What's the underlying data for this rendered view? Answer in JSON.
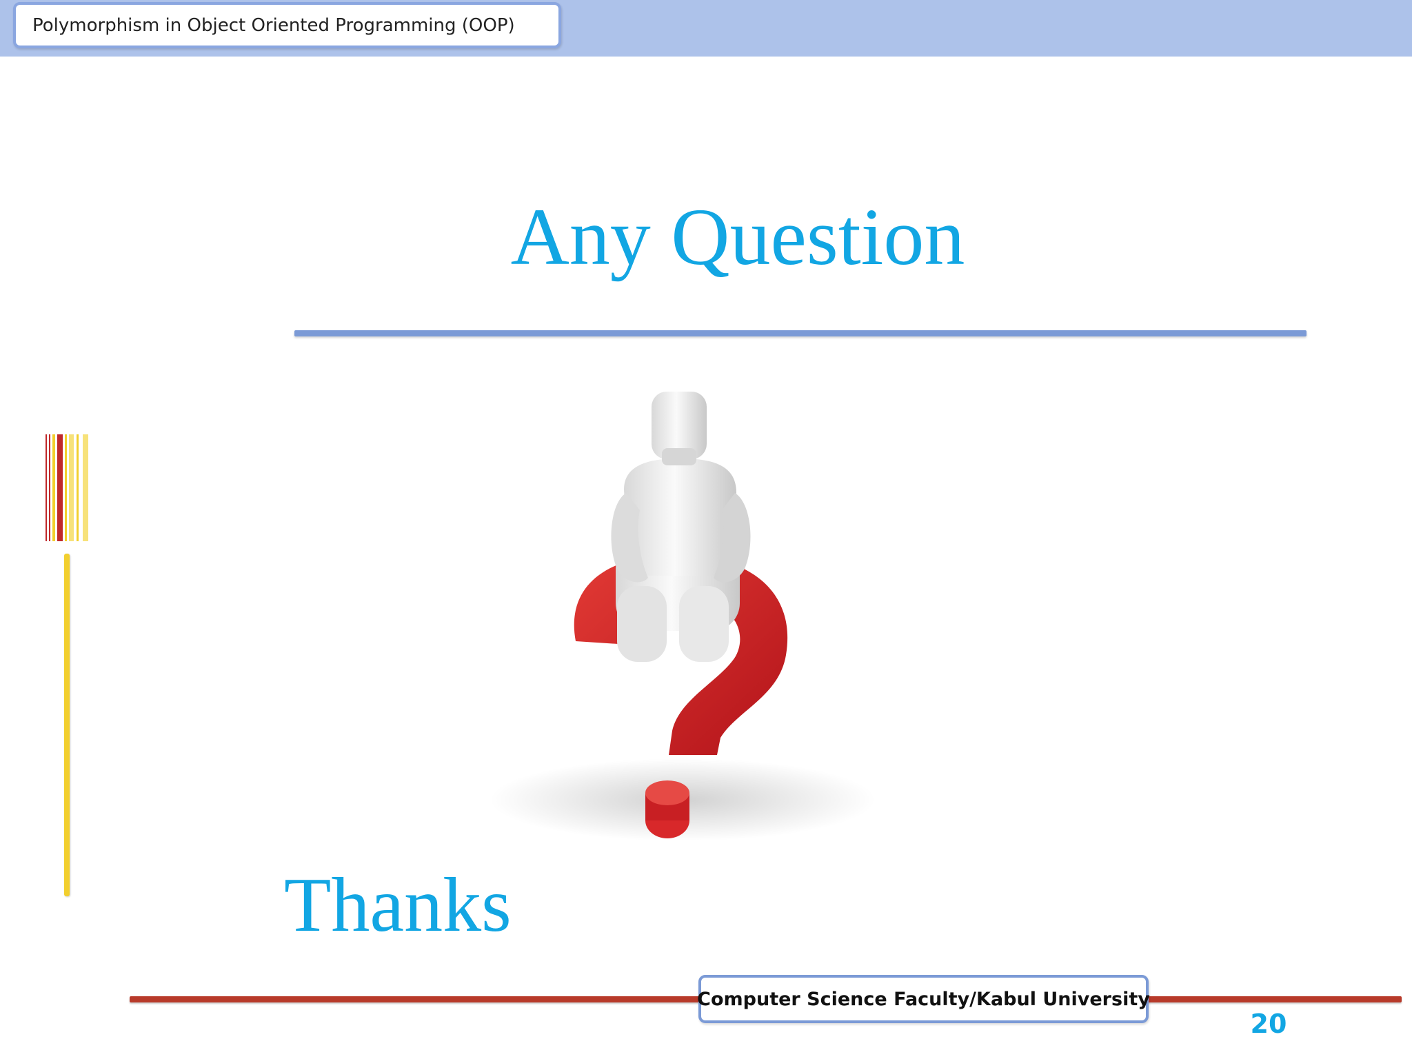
{
  "header": {
    "title": "Polymorphism in Object Oriented Programming (OOP)"
  },
  "slide": {
    "heading": "Any Question",
    "closing": "Thanks",
    "illustration_icon": "question-mark-person-icon"
  },
  "footer": {
    "institution": "Computer Science Faculty/Kabul University",
    "page_number": "20"
  },
  "colors": {
    "accent_blue": "#12a6e3",
    "header_band": "#adc2ea",
    "rule_blue": "#7b9ad6",
    "rule_red": "#b83a2a",
    "stripe_red": "#c0282a",
    "stripe_yellow": "#f2cf2e"
  }
}
